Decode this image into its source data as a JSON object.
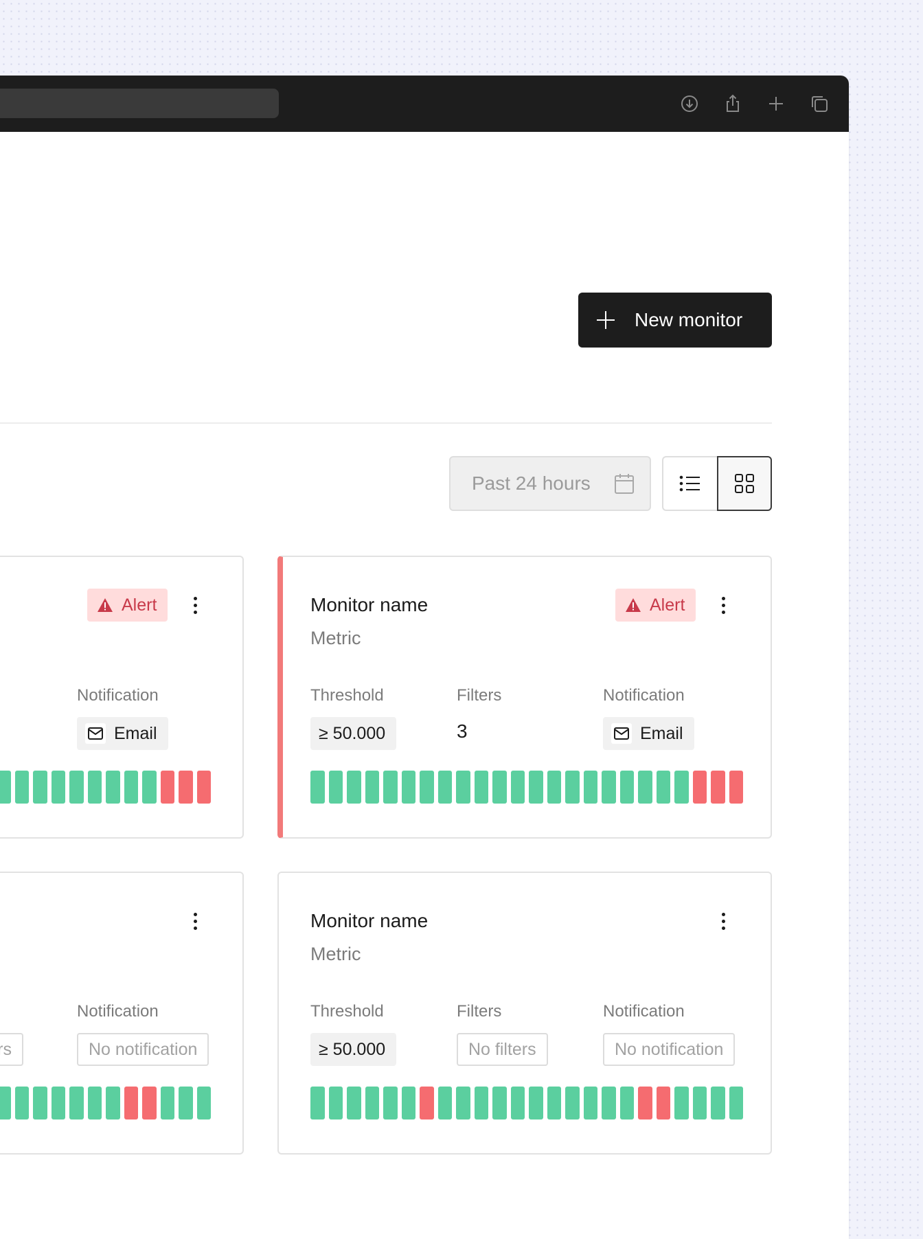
{
  "browser": {
    "toolbar_icons": [
      "download-icon",
      "share-icon",
      "new-tab-icon",
      "tabs-overview-icon"
    ]
  },
  "header": {
    "new_monitor_label": "New monitor"
  },
  "filters": {
    "time_range": "Past 24 hours",
    "view_modes": [
      "list",
      "grid"
    ],
    "active_view": "grid"
  },
  "labels": {
    "threshold": "Threshold",
    "filters": "Filters",
    "notification": "Notification",
    "alert": "Alert"
  },
  "cards": [
    {
      "name": "",
      "metric": "",
      "alert": true,
      "notification": "Email",
      "statuses": [
        "ok",
        "ok",
        "ok",
        "ok",
        "ok",
        "ok",
        "ok",
        "ok",
        "ok",
        "ok",
        "ok",
        "ok",
        "ok",
        "ok",
        "ok",
        "ok",
        "ok",
        "ok",
        "ok",
        "ok",
        "ok",
        "bad",
        "bad",
        "bad"
      ]
    },
    {
      "name": "Monitor name",
      "metric": "Metric",
      "alert": true,
      "threshold": "≥  50.000",
      "filters": "3",
      "notification": "Email",
      "statuses": [
        "ok",
        "ok",
        "ok",
        "ok",
        "ok",
        "ok",
        "ok",
        "ok",
        "ok",
        "ok",
        "ok",
        "ok",
        "ok",
        "ok",
        "ok",
        "ok",
        "ok",
        "ok",
        "ok",
        "ok",
        "ok",
        "bad",
        "bad",
        "bad"
      ]
    },
    {
      "name": "",
      "metric": "",
      "alert": false,
      "filters": "rs",
      "notification": "No notification",
      "statuses": [
        "ok",
        "ok",
        "ok",
        "ok",
        "ok",
        "ok",
        "ok",
        "ok",
        "ok",
        "ok",
        "ok",
        "ok",
        "ok",
        "ok",
        "ok",
        "ok",
        "ok",
        "ok",
        "ok",
        "bad",
        "bad",
        "ok",
        "ok",
        "ok"
      ]
    },
    {
      "name": "Monitor name",
      "metric": "Metric",
      "alert": false,
      "threshold": "≥  50.000",
      "filters": "No filters",
      "notification": "No notification",
      "statuses": [
        "ok",
        "ok",
        "ok",
        "ok",
        "ok",
        "ok",
        "bad",
        "ok",
        "ok",
        "ok",
        "ok",
        "ok",
        "ok",
        "ok",
        "ok",
        "ok",
        "ok",
        "ok",
        "bad",
        "bad",
        "ok",
        "ok",
        "ok",
        "ok"
      ]
    }
  ],
  "colors": {
    "ok": "#5bcf9f",
    "bad": "#f56c70",
    "alert_bg": "#ffdcdc",
    "alert_text": "#c83a4a",
    "alert_edge": "#f27a7a"
  }
}
